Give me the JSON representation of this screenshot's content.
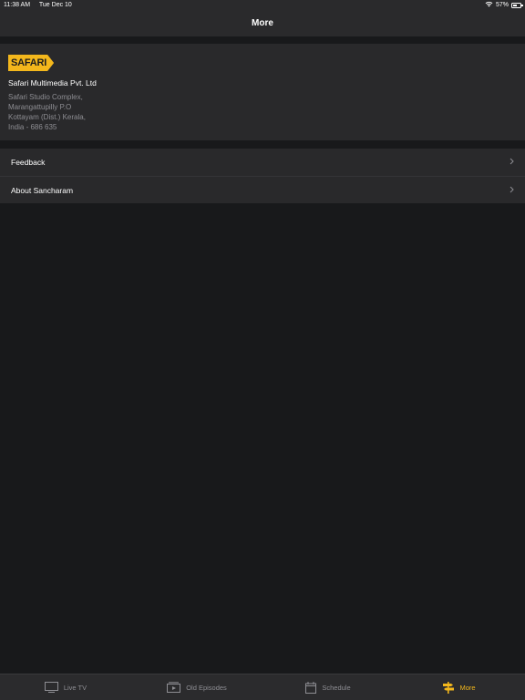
{
  "status": {
    "time": "11:38 AM",
    "date": "Tue Dec 10",
    "battery": "57%",
    "battery_level": 0.57
  },
  "nav": {
    "title": "More"
  },
  "info": {
    "logo_text": "SAFARI",
    "company": "Safari Multimedia Pvt. Ltd",
    "address": [
      "Safari Studio Complex,",
      "Marangattupilly P.O",
      "Kottayam (Dist.) Kerala,",
      "India - 686 635"
    ]
  },
  "menu": [
    {
      "label": "Feedback"
    },
    {
      "label": "About Sancharam"
    }
  ],
  "tabs": [
    {
      "label": "Live TV",
      "icon": "tv-icon"
    },
    {
      "label": "Old Episodes",
      "icon": "video-icon"
    },
    {
      "label": "Schedule",
      "icon": "calendar-icon"
    },
    {
      "label": "More",
      "icon": "signpost-icon",
      "active": true
    }
  ],
  "colors": {
    "accent": "#f3b71c",
    "background": "#18191b",
    "card": "#29292b"
  }
}
